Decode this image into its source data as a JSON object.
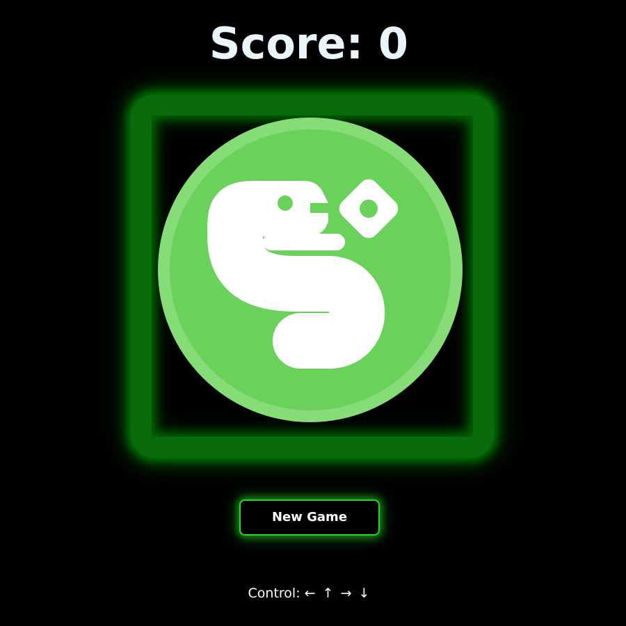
{
  "header": {
    "score_label": "Score: 0",
    "score_value": 0
  },
  "board": {
    "border_color": "#0a6b0a",
    "glow_color": "#00be00",
    "logo_icon": "snake-game-logo-icon",
    "logo_colors": {
      "circle": "#6ad15a",
      "rim": "#86dc77",
      "snake": "#ffffff"
    }
  },
  "actions": {
    "new_game_label": "New Game"
  },
  "footer": {
    "controls_label": "Control:",
    "controls_arrows": "← ↑ → ↓"
  }
}
